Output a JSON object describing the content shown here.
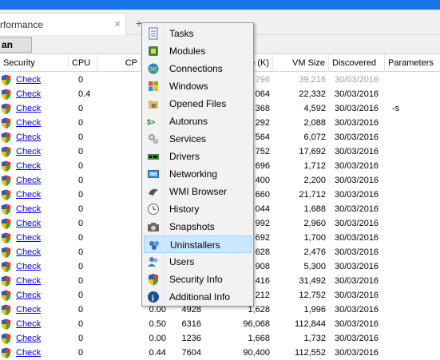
{
  "tab": {
    "label": "rformance",
    "close": "×",
    "new_tab": "+"
  },
  "toolbar": {
    "scan_label": "an"
  },
  "columns": [
    "Security",
    "CPU",
    "CP",
    "e (K)",
    "VM Size",
    "Discovered",
    "Parameters"
  ],
  "rows": [
    {
      "security": "Check",
      "cpu": "0",
      "cp": "",
      "ws": "796",
      "vm": "39,216",
      "disc": "30/03/2016",
      "params": "",
      "grey": true
    },
    {
      "security": "Check",
      "cpu": "0.4",
      "cp": "",
      "ws": "064",
      "vm": "22,332",
      "disc": "30/03/2016",
      "params": ""
    },
    {
      "security": "Check",
      "cpu": "0",
      "cp": "",
      "ws": "368",
      "vm": "4,592",
      "disc": "30/03/2016",
      "params": "-s"
    },
    {
      "security": "Check",
      "cpu": "0",
      "cp": "",
      "ws": "292",
      "vm": "2,088",
      "disc": "30/03/2016",
      "params": ""
    },
    {
      "security": "Check",
      "cpu": "0",
      "cp": "",
      "ws": "564",
      "vm": "6,072",
      "disc": "30/03/2016",
      "params": ""
    },
    {
      "security": "Check",
      "cpu": "0",
      "cp": "",
      "ws": "752",
      "vm": "17,692",
      "disc": "30/03/2016",
      "params": ""
    },
    {
      "security": "Check",
      "cpu": "0",
      "cp": "",
      "ws": "696",
      "vm": "1,712",
      "disc": "30/03/2016",
      "params": ""
    },
    {
      "security": "Check",
      "cpu": "0",
      "cp": "",
      "ws": "400",
      "vm": "2,200",
      "disc": "30/03/2016",
      "params": ""
    },
    {
      "security": "Check",
      "cpu": "0",
      "cp": "",
      "ws": "660",
      "vm": "21,712",
      "disc": "30/03/2016",
      "params": ""
    },
    {
      "security": "Check",
      "cpu": "0",
      "cp": "",
      "ws": "044",
      "vm": "1,688",
      "disc": "30/03/2016",
      "params": ""
    },
    {
      "security": "Check",
      "cpu": "0",
      "cp": "",
      "ws": "992",
      "vm": "2,960",
      "disc": "30/03/2016",
      "params": ""
    },
    {
      "security": "Check",
      "cpu": "0",
      "cp": "",
      "ws": "692",
      "vm": "1,700",
      "disc": "30/03/2016",
      "params": ""
    },
    {
      "security": "Check",
      "cpu": "0",
      "cp": "",
      "ws": "628",
      "vm": "2,476",
      "disc": "30/03/2016",
      "params": ""
    },
    {
      "security": "Check",
      "cpu": "0",
      "cp": "",
      "ws": "908",
      "vm": "5,300",
      "disc": "30/03/2016",
      "params": ""
    },
    {
      "security": "Check",
      "cpu": "0",
      "cp": "",
      "ws": "416",
      "vm": "31,492",
      "disc": "30/03/2016",
      "params": ""
    },
    {
      "security": "Check",
      "cpu": "0",
      "cp": "",
      "ws": "212",
      "vm": "12,752",
      "disc": "30/03/2016",
      "params": ""
    },
    {
      "security": "Check",
      "cpu": "0",
      "cp": "0.00",
      "c2": "4928",
      "ws": "1,628",
      "vm": "1,996",
      "disc": "30/03/2016",
      "params": ""
    },
    {
      "security": "Check",
      "cpu": "0",
      "cp": "0.50",
      "c2": "6316",
      "ws": "96,068",
      "vm": "112,844",
      "disc": "30/03/2016",
      "params": ""
    },
    {
      "security": "Check",
      "cpu": "0",
      "cp": "0.00",
      "c2": "1236",
      "ws": "1,668",
      "vm": "1,732",
      "disc": "30/03/2016",
      "params": ""
    },
    {
      "security": "Check",
      "cpu": "0",
      "cp": "0.44",
      "c2": "7604",
      "ws": "90,400",
      "vm": "112,552",
      "disc": "30/03/2016",
      "params": ""
    }
  ],
  "menu": [
    {
      "label": "Tasks",
      "icon": "tasks-icon"
    },
    {
      "label": "Modules",
      "icon": "modules-icon"
    },
    {
      "label": "Connections",
      "icon": "connections-icon"
    },
    {
      "label": "Windows",
      "icon": "windows-icon"
    },
    {
      "label": "Opened Files",
      "icon": "opened-files-icon"
    },
    {
      "label": "Autoruns",
      "icon": "autoruns-icon"
    },
    {
      "label": "Services",
      "icon": "services-icon"
    },
    {
      "label": "Drivers",
      "icon": "drivers-icon"
    },
    {
      "label": "Networking",
      "icon": "networking-icon"
    },
    {
      "label": "WMI Browser",
      "icon": "wmi-browser-icon"
    },
    {
      "label": "History",
      "icon": "history-icon"
    },
    {
      "label": "Snapshots",
      "icon": "snapshots-icon"
    },
    {
      "label": "Uninstallers",
      "icon": "uninstallers-icon",
      "highlighted": true
    },
    {
      "label": "Users",
      "icon": "users-icon"
    },
    {
      "label": "Security Info",
      "icon": "security-info-icon"
    },
    {
      "label": "Additional Info",
      "icon": "additional-info-icon"
    }
  ],
  "colors": {
    "accent": "#1a73e8",
    "link": "#0000ee",
    "highlight": "#cce8ff"
  }
}
